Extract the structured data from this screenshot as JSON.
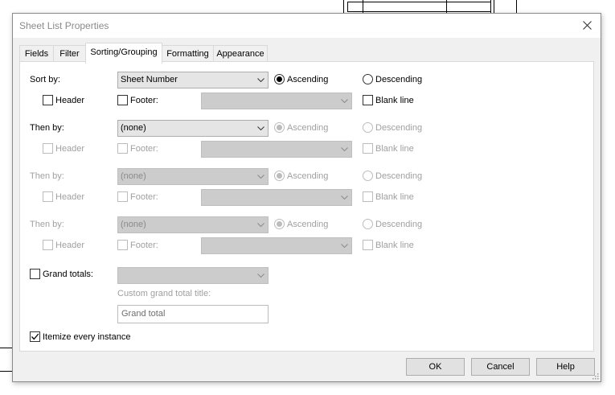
{
  "window": {
    "title": "Sheet List Properties"
  },
  "tabs": [
    {
      "label": "Fields"
    },
    {
      "label": "Filter"
    },
    {
      "label": "Sorting/Grouping"
    },
    {
      "label": "Formatting"
    },
    {
      "label": "Appearance"
    }
  ],
  "rows": [
    {
      "label": "Sort by:",
      "value": "Sheet Number",
      "ascending": "Ascending",
      "descending": "Descending",
      "header": "Header",
      "footer": "Footer:",
      "blank_line": "Blank line"
    },
    {
      "label": "Then by:",
      "value": "(none)",
      "ascending": "Ascending",
      "descending": "Descending",
      "header": "Header",
      "footer": "Footer:",
      "blank_line": "Blank line"
    },
    {
      "label": "Then by:",
      "value": "(none)",
      "ascending": "Ascending",
      "descending": "Descending",
      "header": "Header",
      "footer": "Footer:",
      "blank_line": "Blank line"
    },
    {
      "label": "Then by:",
      "value": "(none)",
      "ascending": "Ascending",
      "descending": "Descending",
      "header": "Header",
      "footer": "Footer:",
      "blank_line": "Blank line"
    }
  ],
  "grand_totals": {
    "label": "Grand totals:",
    "custom_title_label": "Custom grand total title:",
    "custom_title_value": "Grand total"
  },
  "itemize": {
    "label": "Itemize every instance",
    "checked": true
  },
  "buttons": {
    "ok": "OK",
    "cancel": "Cancel",
    "help": "Help"
  }
}
